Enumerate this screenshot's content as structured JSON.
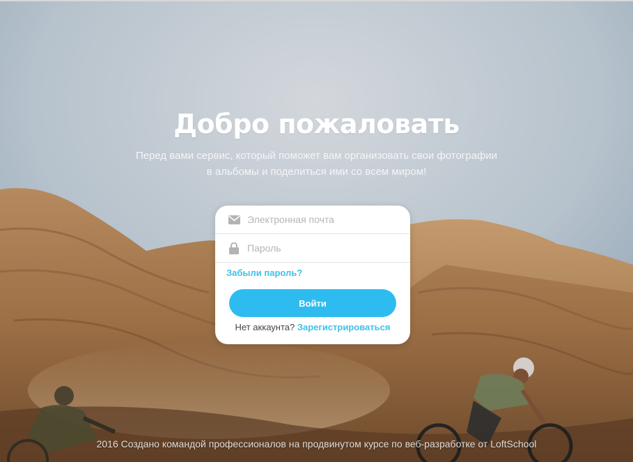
{
  "hero": {
    "title": "Добро пожаловать",
    "subtitle_line1": "Перед вами сервис, который поможет вам организовать свои фотографии",
    "subtitle_line2": "в альбомы и поделиться ими со всем миром!"
  },
  "login_form": {
    "email_placeholder": "Электронная почта",
    "email_icon": "envelope-icon",
    "password_placeholder": "Пароль",
    "password_icon": "lock-icon",
    "forgot_link": "Забыли пароль?",
    "submit_label": "Войти",
    "no_account_text": "Нет аккаунта?",
    "register_link": "Зарегистрироваться"
  },
  "footer": {
    "text": "2016 Создано командой профессионалов на продвинутом курсе по веб-разработке от LoftSchool"
  },
  "colors": {
    "accent": "#2ebcf0",
    "link": "#3ec2ea",
    "sky": "#b9c3cc",
    "terrain": "#a87a4e"
  }
}
